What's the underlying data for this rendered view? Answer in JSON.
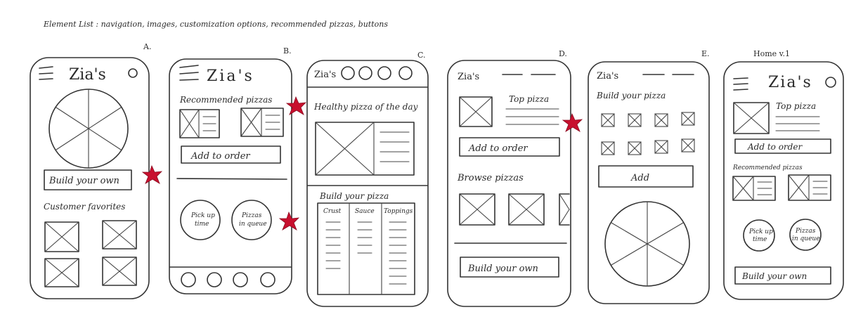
{
  "element_list": "Element List : navigation, images, customization options, recommended pizzas, buttons",
  "letters": [
    "A.",
    "B.",
    "C.",
    "D.",
    "E."
  ],
  "home_label": "Home v.1",
  "logo": "Zia's",
  "logo_spaced": "Zia's",
  "a": {
    "build": "Build your own",
    "favorites": "Customer favorites"
  },
  "b": {
    "recommended": "Recommended pizzas",
    "add": "Add to order",
    "pickup1": "Pick up",
    "pickup2": "time",
    "queue1": "Pizzas",
    "queue2": "in queue"
  },
  "c": {
    "healthy": "Healthy pizza of the day",
    "build": "Build your pizza",
    "crust": "Crust",
    "sauce": "Sauce",
    "toppings": "Toppings"
  },
  "d": {
    "top": "Top pizza",
    "add": "Add to order",
    "browse": "Browse pizzas",
    "build": "Build your own"
  },
  "e": {
    "build": "Build your pizza",
    "add": "Add"
  },
  "home": {
    "top": "Top pizza",
    "add": "Add to order",
    "recommended": "Recommended pizzas",
    "pickup1": "Pick up",
    "pickup2": "time",
    "queue1": "Pizzas",
    "queue2": "in queue",
    "build": "Build your own"
  }
}
